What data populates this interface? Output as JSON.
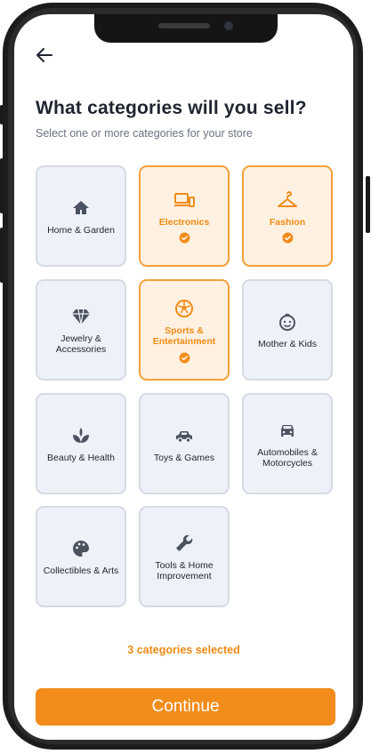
{
  "header": {
    "back_icon": "arrow-left-icon",
    "title": "What categories will you sell?",
    "subtitle": "Select one or more categories for your store"
  },
  "categories": [
    {
      "label": "Home & Garden",
      "icon": "home-icon",
      "selected": false
    },
    {
      "label": "Electronics",
      "icon": "devices-icon",
      "selected": true
    },
    {
      "label": "Fashion",
      "icon": "hanger-icon",
      "selected": true
    },
    {
      "label": "Jewelry & Accessories",
      "icon": "diamond-icon",
      "selected": false
    },
    {
      "label": "Sports & Entertainment",
      "icon": "soccer-ball-icon",
      "selected": true
    },
    {
      "label": "Mother & Kids",
      "icon": "baby-face-icon",
      "selected": false
    },
    {
      "label": "Beauty & Health",
      "icon": "spa-icon",
      "selected": false
    },
    {
      "label": "Toys & Games",
      "icon": "toy-car-icon",
      "selected": false
    },
    {
      "label": "Automobiles & Motorcycles",
      "icon": "car-icon",
      "selected": false
    },
    {
      "label": "Collectibles & Arts",
      "icon": "palette-icon",
      "selected": false
    },
    {
      "label": "Tools & Home Improvement",
      "icon": "wrench-icon",
      "selected": false
    }
  ],
  "status": {
    "selected_count_text": "3 categories selected"
  },
  "footer": {
    "continue_label": "Continue"
  },
  "colors": {
    "accent": "#f28c1a",
    "selected_bg": "#fff1e2",
    "tile_bg": "#eef1f8",
    "text": "#1f2430"
  }
}
